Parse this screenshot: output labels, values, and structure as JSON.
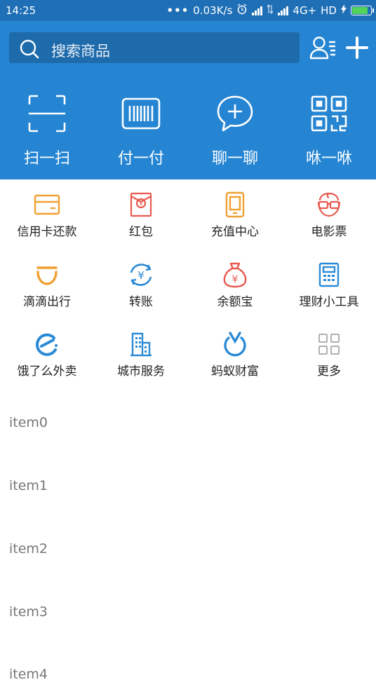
{
  "status_bar": {
    "time": "14:25",
    "dots": "•••",
    "speed": "0.03K/s",
    "network": "4G+",
    "hd": "HD"
  },
  "search": {
    "placeholder": "搜索商品"
  },
  "quick_actions": [
    {
      "label": "扫一扫",
      "icon": "scan-icon"
    },
    {
      "label": "付一付",
      "icon": "barcode-icon"
    },
    {
      "label": "聊一聊",
      "icon": "chat-icon"
    },
    {
      "label": "咻一咻",
      "icon": "qrcode-icon"
    }
  ],
  "services": [
    {
      "label": "信用卡还款",
      "icon": "credit-card-icon",
      "color": "#f0a030"
    },
    {
      "label": "红包",
      "icon": "red-envelope-icon",
      "color": "#e85a4f"
    },
    {
      "label": "充值中心",
      "icon": "phone-icon",
      "color": "#f0a030"
    },
    {
      "label": "电影票",
      "icon": "movie-face-icon",
      "color": "#e85a4f"
    },
    {
      "label": "滴滴出行",
      "icon": "didi-icon",
      "color": "#f0a030"
    },
    {
      "label": "转账",
      "icon": "transfer-icon",
      "color": "#2a8ad6"
    },
    {
      "label": "余额宝",
      "icon": "money-bag-icon",
      "color": "#e85a4f"
    },
    {
      "label": "理财小工具",
      "icon": "calculator-icon",
      "color": "#2a8ad6"
    },
    {
      "label": "饿了么外卖",
      "icon": "eleme-icon",
      "color": "#2a8ad6"
    },
    {
      "label": "城市服务",
      "icon": "building-icon",
      "color": "#2a8ad6"
    },
    {
      "label": "蚂蚁财富",
      "icon": "ant-fortune-icon",
      "color": "#2a8ad6"
    },
    {
      "label": "更多",
      "icon": "more-grid-icon",
      "color": "#b0b0b0"
    }
  ],
  "list": [
    "item0",
    "item1",
    "item2",
    "item3",
    "item4"
  ]
}
